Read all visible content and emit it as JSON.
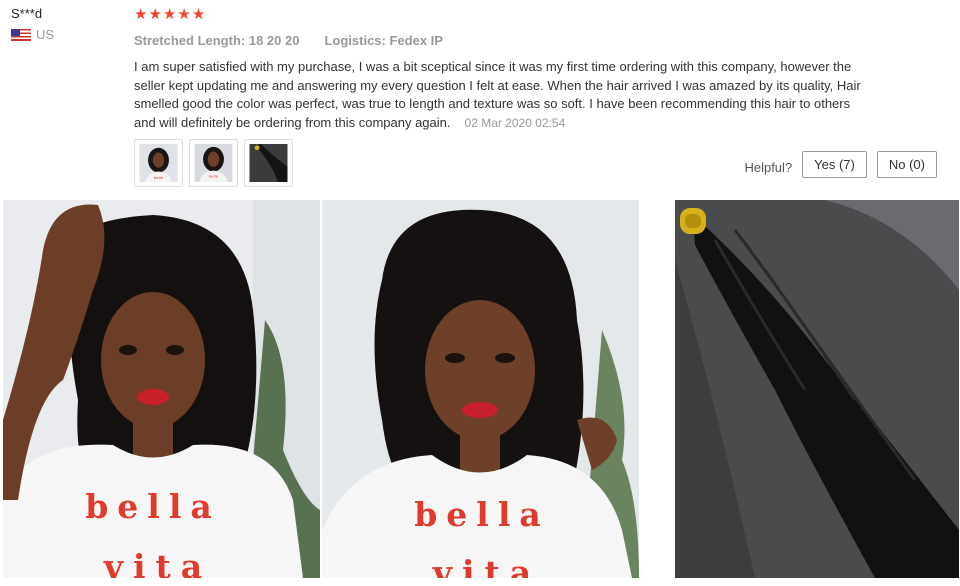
{
  "reviewer": {
    "name": "S***d",
    "country": "US",
    "flag_icon": "us-flag-icon"
  },
  "review": {
    "rating": 5,
    "stars": [
      "★",
      "★",
      "★",
      "★",
      "★"
    ],
    "star_color": "#f0452d",
    "attributes": [
      {
        "label": "Stretched Length:",
        "value": "18 20 20"
      },
      {
        "label": "Logistics:",
        "value": "Fedex IP"
      }
    ],
    "text": "I am super satisfied with my purchase, I was a bit sceptical since it was my first time ordering with this company, however the seller kept updating me and answering my every question I felt at ease. When the hair arrived I was amazed by its quality, Hair smelled good the color was perfect, was true to length and texture was so soft. I have been recommending this hair to others and will definitely be ordering from this company again.",
    "date": "02 Mar 2020 02:54"
  },
  "thumbnails": [
    {
      "name": "thumbnail-woman-curly-bob-1",
      "shirt_text": "bella"
    },
    {
      "name": "thumbnail-woman-curly-bob-2",
      "shirt_text": "bella vita"
    },
    {
      "name": "thumbnail-curly-hair-bundle"
    }
  ],
  "helpful": {
    "label": "Helpful?",
    "yes_label": "Yes (7)",
    "no_label": "No (0)"
  },
  "photos": [
    {
      "name": "review-photo-1",
      "shirt_text_line1": "bella",
      "shirt_text_line2": "vita"
    },
    {
      "name": "review-photo-2",
      "shirt_text_line1": "bella",
      "shirt_text_line2": "vita"
    },
    {
      "name": "review-photo-3"
    }
  ]
}
